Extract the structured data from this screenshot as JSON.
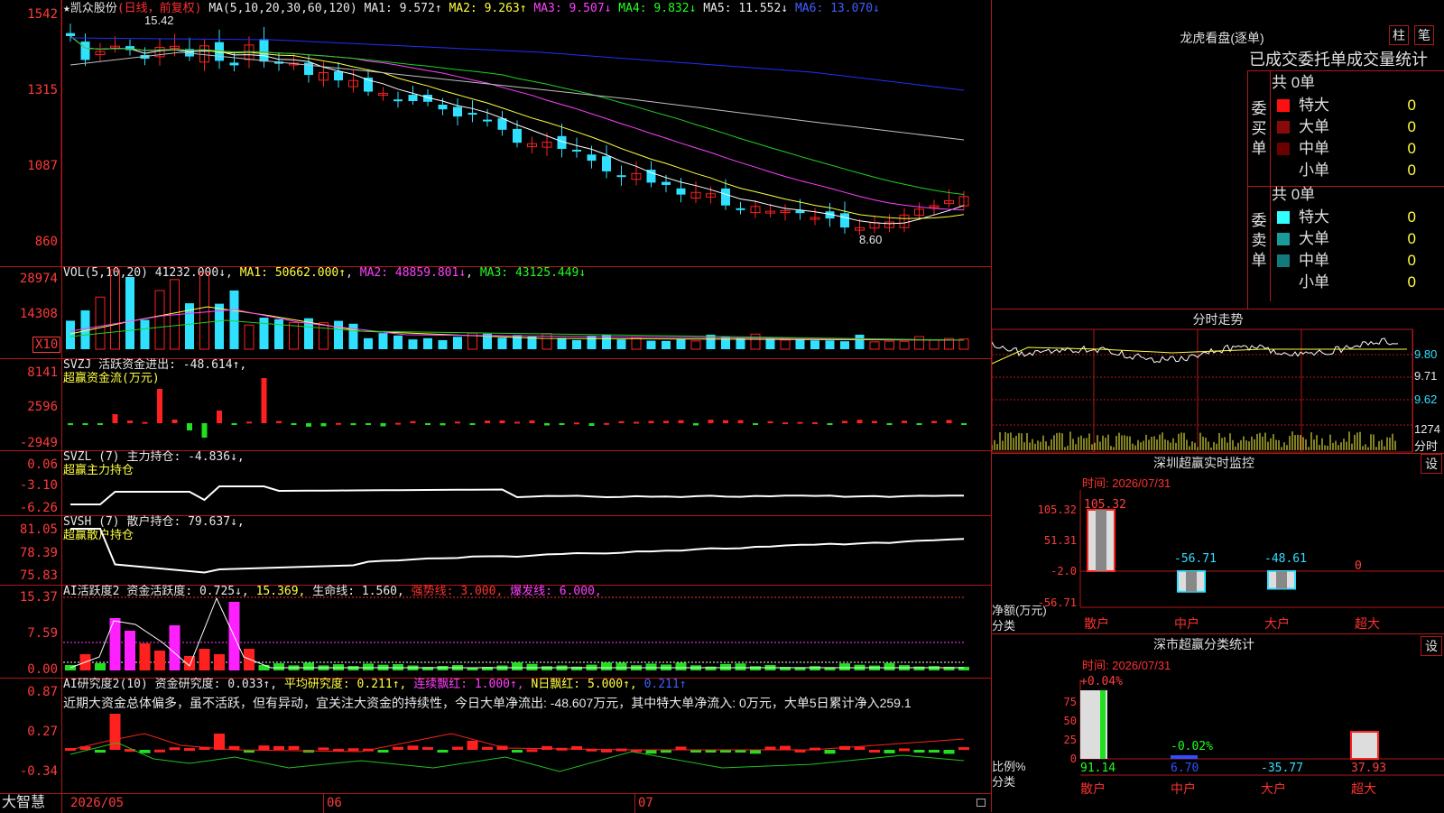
{
  "stock": {
    "star": "★",
    "name": "凯众股份",
    "period": "(日线，前复权)"
  },
  "main_pane": {
    "ma_header": "MA(5,10,20,30,60,120)",
    "ma1": "MA1: 9.572↑",
    "ma2": "MA2: 9.263↑",
    "ma3": "MA3: 9.507↓",
    "ma4": "MA4: 9.832↓",
    "ma5": "MA5: 11.552↓",
    "ma6": "MA6: 13.070↓",
    "yticks": [
      "1542",
      "1315",
      "1087",
      "860"
    ],
    "high_label": "15.42",
    "low_label": "8.60"
  },
  "vol_pane": {
    "header": "VOL(5,10,20)",
    "value": "41232.000↓",
    "ma1": "MA1: 50662.000↑",
    "ma2": "MA2: 48859.801↓",
    "ma3": "MA3: 43125.449↓",
    "yticks": [
      "28974",
      "14308"
    ],
    "unit": "X10"
  },
  "svzj_pane": {
    "header": "SVZJ",
    "title": "活跃资金进出: -48.614↑,",
    "subtitle": "超赢资金流(万元)",
    "yticks": [
      "8141",
      "2596",
      "-2949"
    ]
  },
  "svzl_pane": {
    "header": "SVZL (7)",
    "title": "主力持仓: -4.836↓,",
    "subtitle": "超赢主力持仓",
    "yticks": [
      "0.06",
      "-3.10",
      "-6.26"
    ]
  },
  "svsh_pane": {
    "header": "SVSH (7)",
    "title": "散户持仓: 79.637↓,",
    "subtitle": "超赢散户持仓",
    "yticks": [
      "81.05",
      "78.39",
      "75.83"
    ]
  },
  "ai1_pane": {
    "header": "AI活跃度2",
    "a": "资金活跃度: 0.725↓,",
    "b": "15.369,",
    "c": "生命线: 1.560,",
    "d": "强势线: 3.000,",
    "e": "爆发线: 6.000,",
    "yticks": [
      "15.37",
      "7.59",
      "0.00"
    ]
  },
  "ai2_pane": {
    "header": "AI研究度2(10)",
    "a": "资金研究度: 0.033↑,",
    "b": "平均研究度: 0.211↑,",
    "c": "连续飘红: 1.000↑,",
    "d": "N日飘红: 5.000↑,",
    "e": "0.211↑",
    "comment": "近期大资金总体偏多，虽不活跃，但有异动，宜关注大资金的持续性，今日大单净流出: -48.607万元，其中特大单净流入: 0万元，大单5日累计净入259.1",
    "yticks": [
      "0.87",
      "0.27",
      "-0.34"
    ]
  },
  "bottom_bar": {
    "logo": "大智慧",
    "dates": [
      "2026/05",
      "06",
      "07"
    ]
  },
  "dragon": {
    "title": "龙虎看盘(逐单)",
    "btn1": "柱",
    "btn2": "笔",
    "section_title": "已成交委托单成交量统计",
    "buy": {
      "side_label": "委买单",
      "total": "共 0单",
      "rows": [
        {
          "label": "特大",
          "num": "0",
          "pct": "0%",
          "color": "#ff1010"
        },
        {
          "label": "大单",
          "num": "0",
          "pct": "0%",
          "color": "#8a0a0a"
        },
        {
          "label": "中单",
          "num": "0",
          "pct": "0%",
          "color": "#6a0000"
        },
        {
          "label": "小单",
          "num": "0",
          "pct": "0%",
          "color": "#000000"
        }
      ]
    },
    "sell": {
      "side_label": "委卖单",
      "total": "共 0单",
      "rows": [
        {
          "label": "特大",
          "num": "0",
          "pct": "0%",
          "color": "#30ffff"
        },
        {
          "label": "大单",
          "num": "0",
          "pct": "0%",
          "color": "#1a9a9a"
        },
        {
          "label": "中单",
          "num": "0",
          "pct": "0%",
          "color": "#127a7a"
        },
        {
          "label": "小单",
          "num": "0",
          "pct": "0%",
          "color": "#000000"
        }
      ]
    }
  },
  "intraday": {
    "title": "分时走势",
    "yticks": [
      "9.80",
      "9.71",
      "9.62",
      "1274"
    ],
    "unit": "分时"
  },
  "monitor": {
    "title": "深圳超赢实时监控",
    "time": "时间: 2026/07/31",
    "set": "设",
    "ylabel": "净额(万元)",
    "xlabel": "分类",
    "yticks": [
      "105.32",
      "51.31",
      "-2.0",
      "-56.71"
    ],
    "bars": [
      {
        "cat": "散户",
        "value": 105.32,
        "label": "105.32"
      },
      {
        "cat": "中户",
        "value": -56.71,
        "label": "-56.71"
      },
      {
        "cat": "大户",
        "value": -48.61,
        "label": "-48.61"
      },
      {
        "cat": "超大",
        "value": 0,
        "label": "0"
      }
    ]
  },
  "classify": {
    "title": "深市超赢分类统计",
    "time": "时间: 2026/07/31",
    "set": "设",
    "ylabel": "比例%",
    "xlabel": "分类",
    "yticks": [
      "75",
      "50",
      "25",
      "0"
    ],
    "top_labels": [
      "+0.04%",
      "-0.02%"
    ],
    "bars": [
      {
        "cat": "散户",
        "value": 91.14,
        "label": "91.14"
      },
      {
        "cat": "中户",
        "value": 6.7,
        "label": "6.70"
      },
      {
        "cat": "大户",
        "value": -35.77,
        "label": "-35.77"
      },
      {
        "cat": "超大",
        "value": 37.93,
        "label": "37.93"
      }
    ]
  },
  "colors": {
    "up": "#ff2020",
    "down": "#30e0ff",
    "grid": "#b01818",
    "ma5": "#ffffff",
    "ma10": "#ffff40",
    "ma20": "#ff40ff",
    "ma30": "#20d020",
    "ma60": "#c0c0c0",
    "ma120": "#2030ff"
  }
}
